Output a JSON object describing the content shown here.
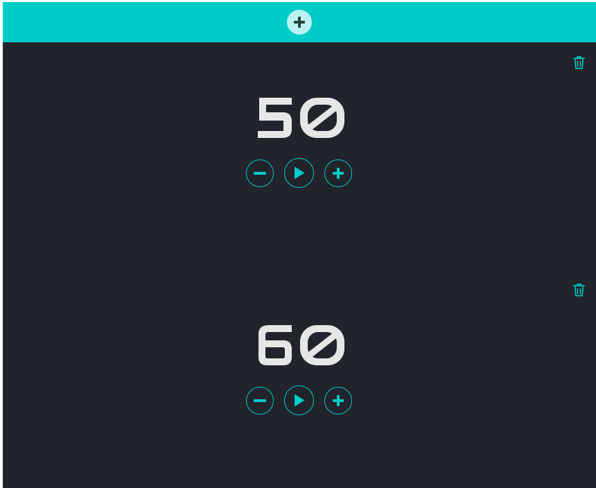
{
  "topbar": {
    "add_icon": "plus-icon",
    "accent_color": "#00cdc8",
    "add_button_bg": "#b9f2f0"
  },
  "timers": [
    {
      "value": "50",
      "delete_icon": "trash-icon",
      "controls": [
        "minus-icon",
        "play-icon",
        "plus-icon"
      ]
    },
    {
      "value": "60",
      "delete_icon": "trash-icon",
      "controls": [
        "minus-icon",
        "play-icon",
        "plus-icon"
      ]
    }
  ],
  "colors": {
    "background": "#21242b",
    "digits": "#e6e6e6",
    "accent": "#00cdc8"
  }
}
